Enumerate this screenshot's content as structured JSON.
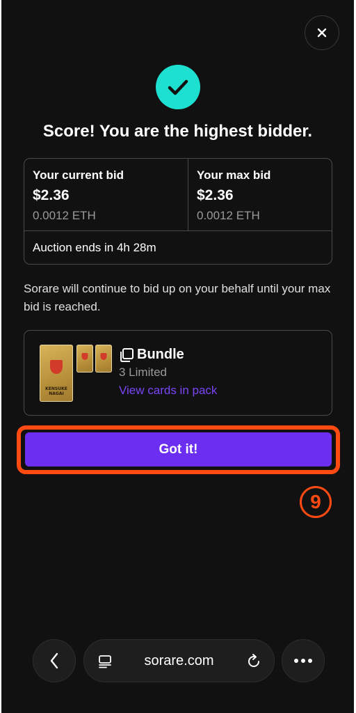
{
  "modal": {
    "headline": "Score! You are the highest bidder.",
    "current_bid": {
      "label": "Your current bid",
      "usd": "$2.36",
      "eth": "0.0012 ETH"
    },
    "max_bid": {
      "label": "Your max bid",
      "usd": "$2.36",
      "eth": "0.0012 ETH"
    },
    "auction_ends": "Auction ends in 4h 28m",
    "info": "Sorare will continue to bid up on your behalf until your max bid is reached.",
    "bundle": {
      "title": "Bundle",
      "subtitle": "3 Limited",
      "link": "View cards in pack",
      "player_name": "KENSUKE NAGAI"
    },
    "confirm_label": "Got it!"
  },
  "annotation": {
    "step_label": "9",
    "color": "#ff4a12"
  },
  "browser": {
    "url": "sorare.com"
  },
  "colors": {
    "background": "#111111",
    "accent": "#6c2ff2",
    "success": "#1de0d0",
    "link": "#7a45f5"
  },
  "icons": {
    "close": "close-icon",
    "success": "check-icon",
    "bundle": "copy-icon",
    "back": "chevron-left-icon",
    "reader": "reader-mode-icon",
    "reload": "reload-icon",
    "more": "more-icon"
  }
}
